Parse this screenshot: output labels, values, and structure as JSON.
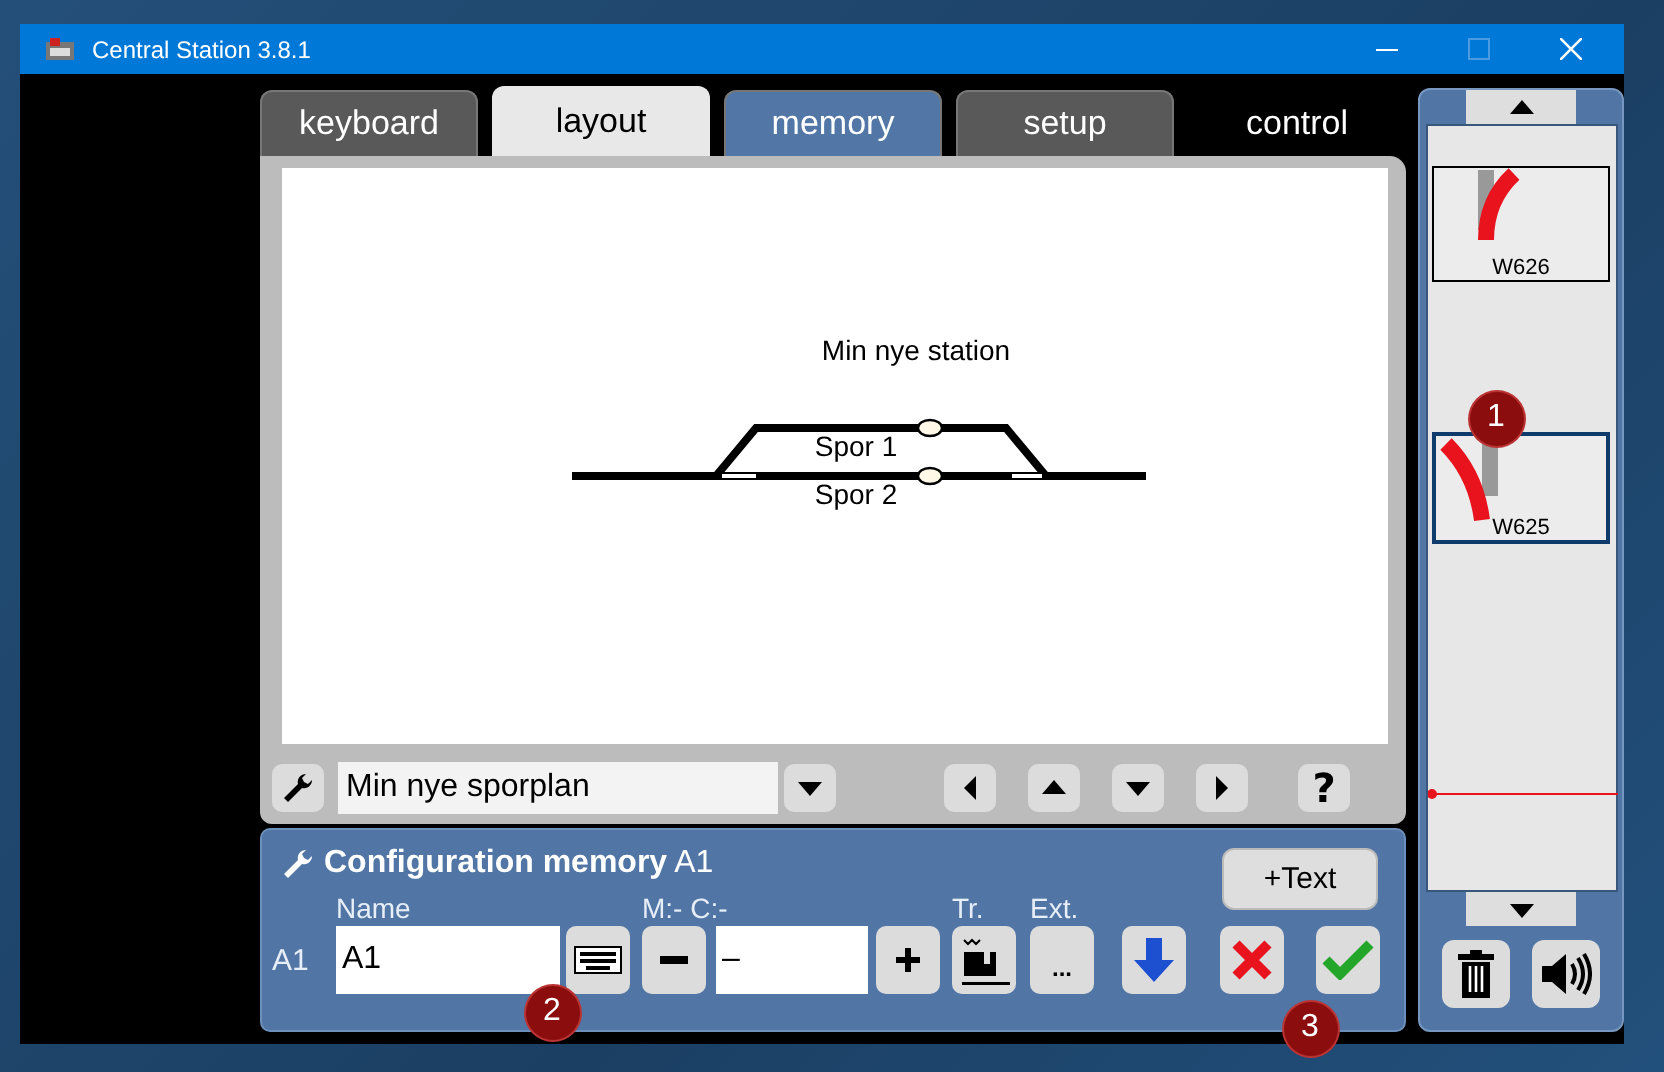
{
  "window": {
    "title": "Central Station 3.8.1",
    "maximize_disabled": true
  },
  "tabs": [
    {
      "label": "keyboard",
      "selected": false,
      "kind": "tab",
      "color": "#595959"
    },
    {
      "label": "layout",
      "selected": true,
      "kind": "tab",
      "color": "#e8e8e8"
    },
    {
      "label": "memory",
      "selected": false,
      "kind": "tab",
      "color": "#5277a6"
    },
    {
      "label": "setup",
      "selected": false,
      "kind": "tab",
      "color": "#595959"
    },
    {
      "label": "control",
      "selected": false,
      "kind": "plain",
      "color": "#000000"
    }
  ],
  "layout": {
    "title": "Min nye station",
    "tracks": [
      {
        "label": "Spor 1"
      },
      {
        "label": "Spor 2"
      }
    ],
    "plan": "Min nye sporplan",
    "help": "?"
  },
  "config": {
    "title": "**Configuration memory** A1",
    "add_text_button": "+Text",
    "row_label": "A1",
    "name_label": "Name",
    "name_value": "A1",
    "address_label": "M:- C:-",
    "address_value": "–",
    "tr_label": "Tr.",
    "ext_label": "Ext.",
    "ext_button": "..."
  },
  "articles": [
    {
      "label": "W626",
      "selected": false,
      "kind": "right"
    },
    {
      "label": "W625",
      "selected": true,
      "kind": "left"
    }
  ],
  "callouts": [
    "1",
    "2",
    "3"
  ]
}
